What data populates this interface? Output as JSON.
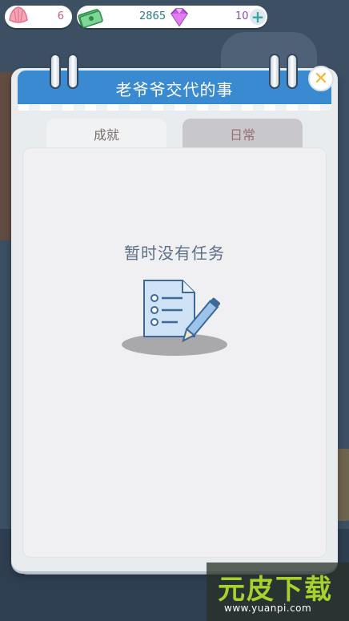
{
  "hud": {
    "shell_count": "6",
    "money": "2865",
    "gems": "10",
    "plus_label": "+"
  },
  "panel": {
    "title": "老爷爷交代的事",
    "close_label": "✕"
  },
  "tabs": [
    {
      "label": "成就",
      "active": true
    },
    {
      "label": "日常",
      "active": false
    }
  ],
  "empty_state": {
    "message": "暂时没有任务",
    "icon": "task-list-pencil-icon"
  },
  "watermark": {
    "brand": "元皮下载",
    "url": "www.yuanpi.com"
  },
  "colors": {
    "header": "#3a8ad2",
    "tab_active": "#f0f2f4",
    "tab_inactive": "#c8c8cc",
    "empty_text": "#5b6f86",
    "close_icon": "#f3b830"
  }
}
